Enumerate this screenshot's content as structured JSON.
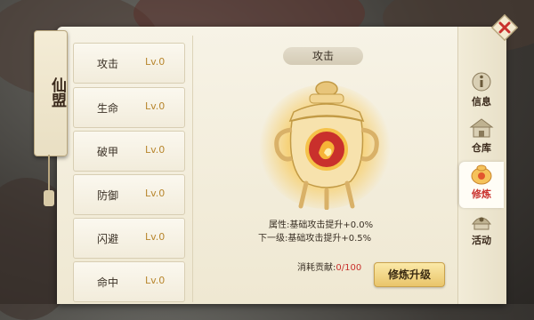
{
  "side_title": "仙盟",
  "list": [
    {
      "name": "攻击",
      "level": "Lv.0"
    },
    {
      "name": "生命",
      "level": "Lv.0"
    },
    {
      "name": "破甲",
      "level": "Lv.0"
    },
    {
      "name": "防御",
      "level": "Lv.0"
    },
    {
      "name": "闪避",
      "level": "Lv.0"
    },
    {
      "name": "命中",
      "level": "Lv.0"
    }
  ],
  "detail": {
    "title": "攻击",
    "current_attr": "属性:基础攻击提升+0.0%",
    "next_attr": "下一级:基础攻击提升+0.5%",
    "cost_label": "消耗贡献:",
    "cost_value": "0/100",
    "upgrade_button": "修炼升级"
  },
  "tabs": [
    {
      "label": "信息",
      "icon": "info-icon"
    },
    {
      "label": "仓库",
      "icon": "warehouse-icon"
    },
    {
      "label": "修炼",
      "icon": "cultivate-icon",
      "active": true
    },
    {
      "label": "活动",
      "icon": "activity-icon"
    }
  ],
  "colors": {
    "accent_red": "#c9302c",
    "level_gold": "#b8862e"
  }
}
